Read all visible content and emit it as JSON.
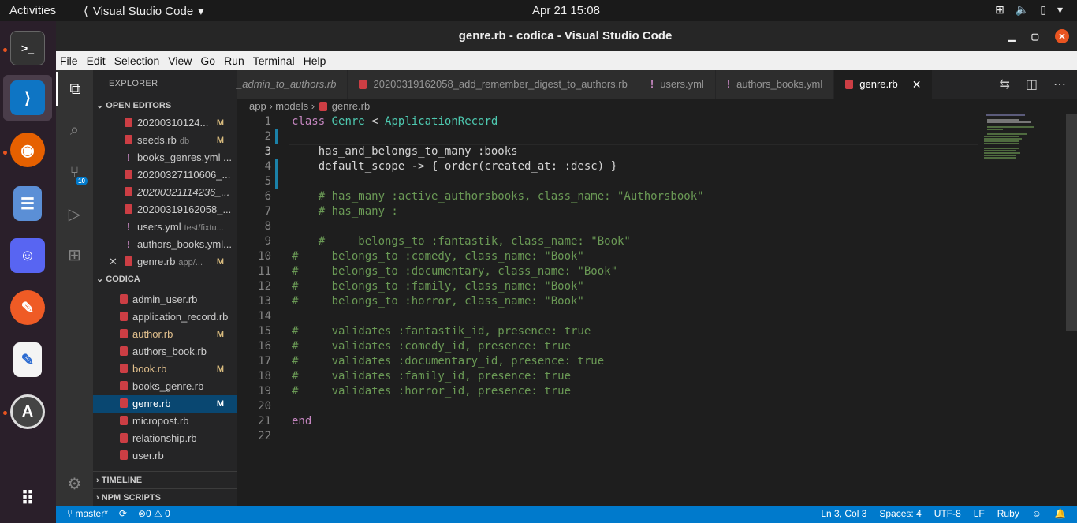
{
  "topbar": {
    "activities": "Activities",
    "app_name": "Visual Studio Code",
    "clock": "Apr 21  15:08"
  },
  "window": {
    "title": "genre.rb - codica - Visual Studio Code"
  },
  "menu": [
    "File",
    "Edit",
    "Selection",
    "View",
    "Go",
    "Run",
    "Terminal",
    "Help"
  ],
  "activity": {
    "scm_badge": "10"
  },
  "sidebar": {
    "title": "EXPLORER",
    "open_editors_label": "OPEN EDITORS",
    "open_editors": [
      {
        "name": "20200310124...",
        "desc": "",
        "status": "M",
        "icon": "ruby"
      },
      {
        "name": "seeds.rb",
        "desc": "db",
        "status": "M",
        "icon": "ruby"
      },
      {
        "name": "books_genres.yml ...",
        "desc": "",
        "status": "",
        "icon": "yaml"
      },
      {
        "name": "20200327110606_...",
        "desc": "",
        "status": "",
        "icon": "ruby"
      },
      {
        "name": "20200321114236_...",
        "desc": "",
        "status": "",
        "icon": "ruby"
      },
      {
        "name": "20200319162058_...",
        "desc": "",
        "status": "",
        "icon": "ruby"
      },
      {
        "name": "users.yml",
        "desc": "test/fixtu...",
        "status": "",
        "icon": "yaml"
      },
      {
        "name": "authors_books.yml...",
        "desc": "",
        "status": "",
        "icon": "yaml"
      },
      {
        "name": "genre.rb",
        "desc": "app/...",
        "status": "M",
        "icon": "ruby"
      }
    ],
    "project_label": "CODICA",
    "files": [
      {
        "name": "admin_user.rb",
        "status": ""
      },
      {
        "name": "application_record.rb",
        "status": ""
      },
      {
        "name": "author.rb",
        "status": "M"
      },
      {
        "name": "authors_book.rb",
        "status": ""
      },
      {
        "name": "book.rb",
        "status": "M"
      },
      {
        "name": "books_genre.rb",
        "status": ""
      },
      {
        "name": "genre.rb",
        "status": "M"
      },
      {
        "name": "micropost.rb",
        "status": ""
      },
      {
        "name": "relationship.rb",
        "status": ""
      },
      {
        "name": "user.rb",
        "status": ""
      }
    ],
    "timeline_label": "TIMELINE",
    "npm_label": "NPM SCRIPTS"
  },
  "tabs": [
    {
      "label": "_admin_to_authors.rb",
      "icon": "ruby"
    },
    {
      "label": "20200319162058_add_remember_digest_to_authors.rb",
      "icon": "ruby"
    },
    {
      "label": "users.yml",
      "icon": "yaml"
    },
    {
      "label": "authors_books.yml",
      "icon": "yaml"
    },
    {
      "label": "genre.rb",
      "icon": "ruby",
      "active": true
    }
  ],
  "breadcrumb": [
    "app",
    "models",
    "genre.rb"
  ],
  "editor": {
    "line_numbers": [
      "1",
      "2",
      "3",
      "4",
      "5",
      "6",
      "7",
      "8",
      "9",
      "10",
      "11",
      "12",
      "13",
      "14",
      "15",
      "16",
      "17",
      "18",
      "19",
      "20",
      "21",
      "22"
    ]
  },
  "status": {
    "branch": "master*",
    "errors": "0",
    "warnings": "0",
    "position": "Ln 3, Col 3",
    "spaces": "Spaces: 4",
    "encoding": "UTF-8",
    "eol": "LF",
    "language": "Ruby"
  }
}
